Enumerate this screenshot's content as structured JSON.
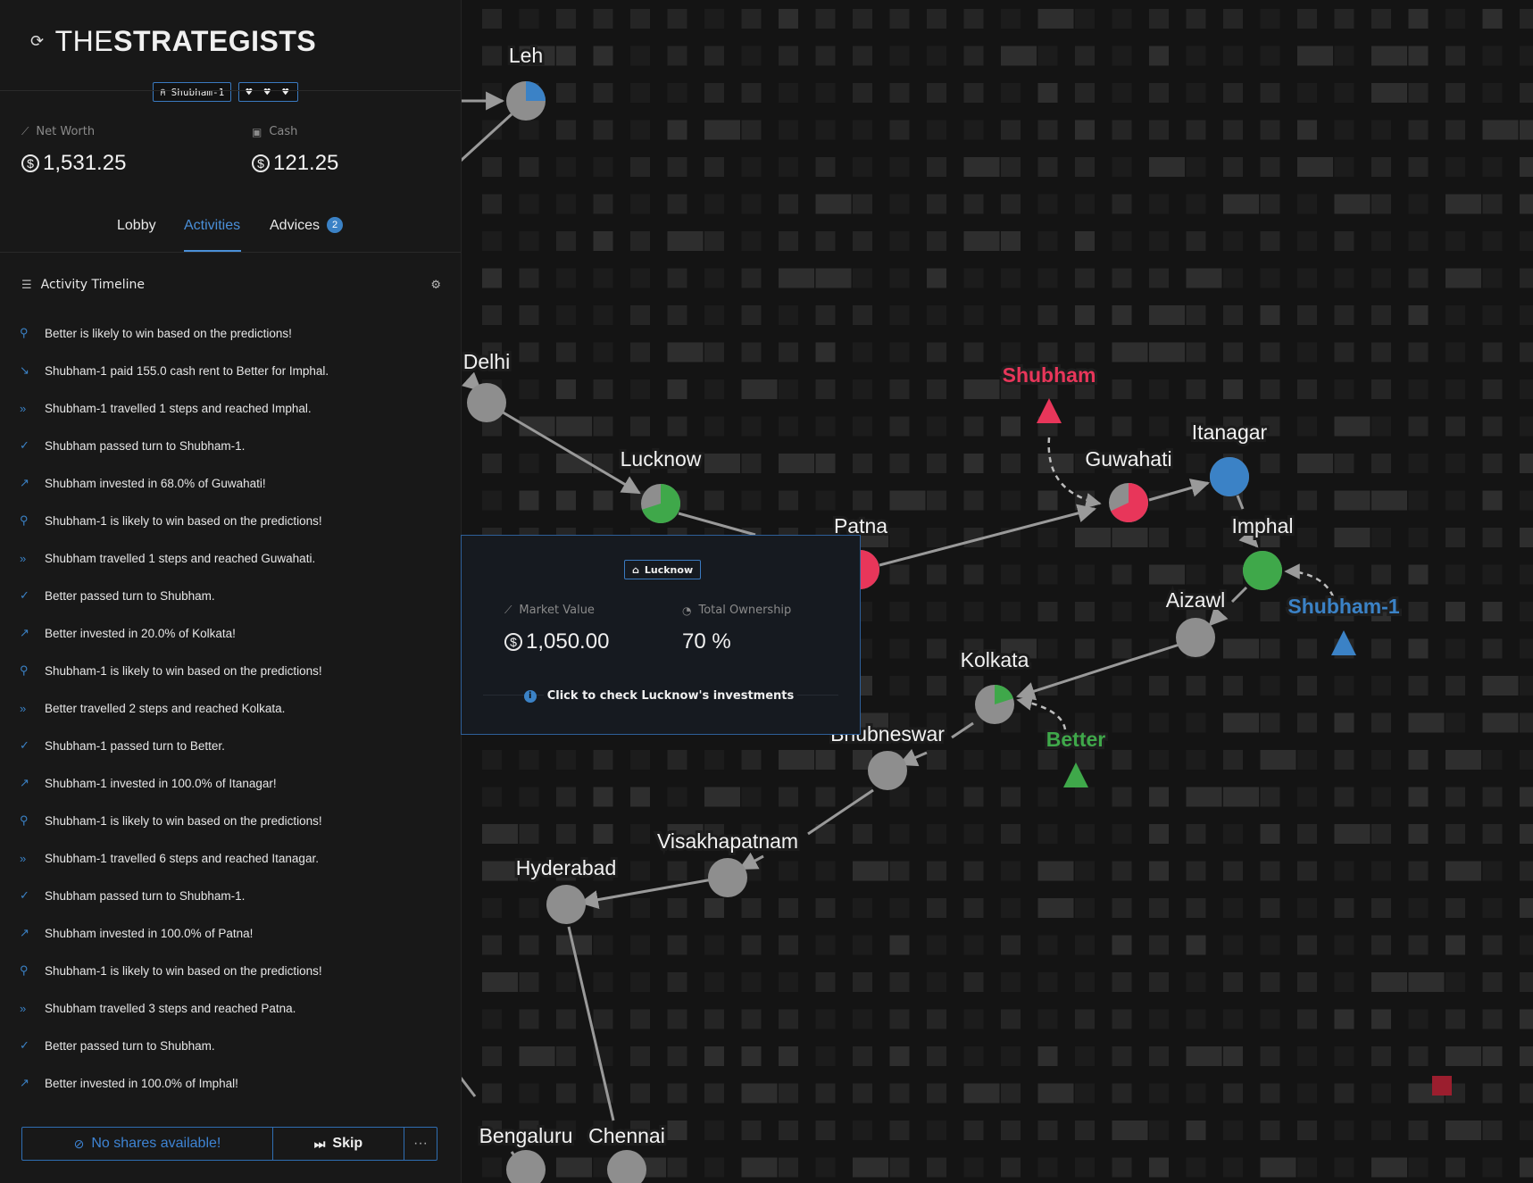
{
  "brand": {
    "prefix": "THE",
    "name": "STRATEGISTS"
  },
  "player": {
    "name": "Shubham-1",
    "lives": "♥ ♥ ♥"
  },
  "stats": {
    "net_worth_label": "Net Worth",
    "net_worth_value": "1,531.25",
    "cash_label": "Cash",
    "cash_value": "121.25"
  },
  "tabs": [
    {
      "label": "Lobby"
    },
    {
      "label": "Activities",
      "active": true
    },
    {
      "label": "Advices",
      "badge": "2"
    }
  ],
  "timeline": {
    "title": "Activity Timeline",
    "events": [
      {
        "icon": "bulb",
        "text": "Better is likely to win based on the predictions!"
      },
      {
        "icon": "rent",
        "text": "Shubham-1 paid 155.0 cash rent to Better for Imphal."
      },
      {
        "icon": "travel",
        "text": "Shubham-1 travelled 1 steps and reached Imphal."
      },
      {
        "icon": "check",
        "text": "Shubham passed turn to Shubham-1."
      },
      {
        "icon": "invest",
        "text": "Shubham invested in 68.0% of Guwahati!"
      },
      {
        "icon": "bulb",
        "text": "Shubham-1 is likely to win based on the predictions!"
      },
      {
        "icon": "travel",
        "text": "Shubham travelled 1 steps and reached Guwahati."
      },
      {
        "icon": "check",
        "text": "Better passed turn to Shubham."
      },
      {
        "icon": "invest",
        "text": "Better invested in 20.0% of Kolkata!"
      },
      {
        "icon": "bulb",
        "text": "Shubham-1 is likely to win based on the predictions!"
      },
      {
        "icon": "travel",
        "text": "Better travelled 2 steps and reached Kolkata."
      },
      {
        "icon": "check",
        "text": "Shubham-1 passed turn to Better."
      },
      {
        "icon": "invest",
        "text": "Shubham-1 invested in 100.0% of Itanagar!"
      },
      {
        "icon": "bulb",
        "text": "Shubham-1 is likely to win based on the predictions!"
      },
      {
        "icon": "travel",
        "text": "Shubham-1 travelled 6 steps and reached Itanagar."
      },
      {
        "icon": "check",
        "text": "Shubham passed turn to Shubham-1."
      },
      {
        "icon": "invest",
        "text": "Shubham invested in 100.0% of Patna!"
      },
      {
        "icon": "bulb",
        "text": "Shubham-1 is likely to win based on the predictions!"
      },
      {
        "icon": "travel",
        "text": "Shubham travelled 3 steps and reached Patna."
      },
      {
        "icon": "check",
        "text": "Better passed turn to Shubham."
      },
      {
        "icon": "invest",
        "text": "Better invested in 100.0% of Imphal!"
      }
    ]
  },
  "actions": {
    "no_shares": "No shares available!",
    "skip": "Skip",
    "more": "···"
  },
  "popup": {
    "city": "Lucknow",
    "market_value_label": "Market Value",
    "market_value": "1,050.00",
    "ownership_label": "Total Ownership",
    "ownership": "70 %",
    "cta": "Click to check Lucknow's investments"
  },
  "map": {
    "cities": [
      {
        "name": "Leh",
        "owner_fraction": 0.25,
        "owner_color": "#3b82c6"
      },
      {
        "name": "Delhi",
        "owner_fraction": 0
      },
      {
        "name": "Lucknow",
        "owner_fraction": 0.7,
        "owner_color": "#3fa84a"
      },
      {
        "name": "Patna",
        "owner_fraction": 1.0,
        "owner_color": "#e8365a"
      },
      {
        "name": "Guwahati",
        "owner_fraction": 0.68,
        "owner_color": "#e8365a"
      },
      {
        "name": "Itanagar",
        "owner_fraction": 1.0,
        "owner_color": "#3b82c6"
      },
      {
        "name": "Imphal",
        "owner_fraction": 1.0,
        "owner_color": "#3fa84a"
      },
      {
        "name": "Aizawl",
        "owner_fraction": 0
      },
      {
        "name": "Kolkata",
        "owner_fraction": 0.2,
        "owner_color": "#3fa84a"
      },
      {
        "name": "Bhubneswar",
        "owner_fraction": 0
      },
      {
        "name": "Visakhapatnam",
        "owner_fraction": 0
      },
      {
        "name": "Hyderabad",
        "owner_fraction": 0
      },
      {
        "name": "Bengaluru",
        "owner_fraction": 0
      },
      {
        "name": "Chennai",
        "owner_fraction": 0
      }
    ],
    "players": [
      {
        "name": "Shubham",
        "color": "#e8365a"
      },
      {
        "name": "Shubham-1",
        "color": "#3b82c6"
      },
      {
        "name": "Better",
        "color": "#3fa84a"
      }
    ]
  }
}
